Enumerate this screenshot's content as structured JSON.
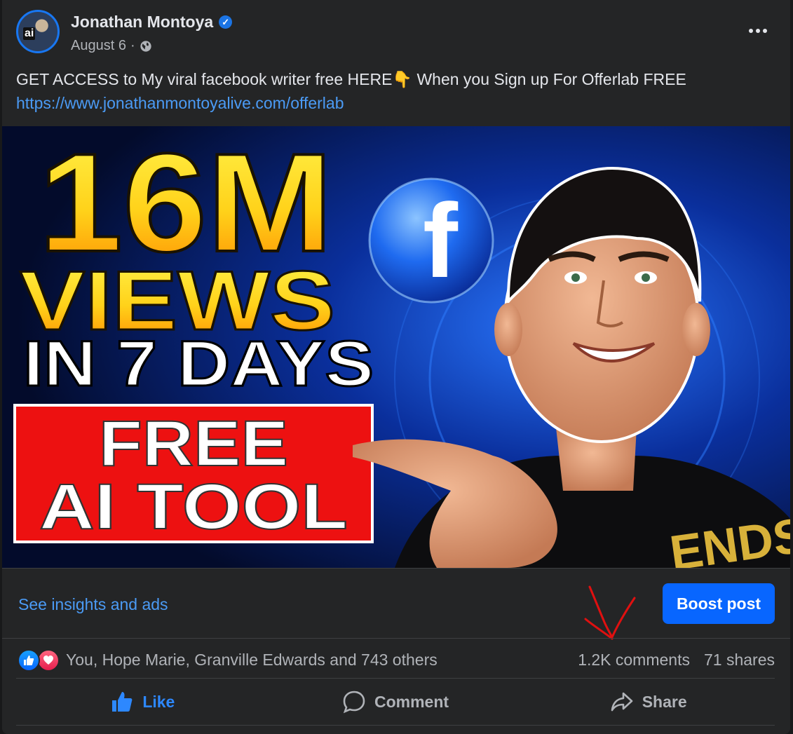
{
  "post": {
    "author": "Jonathan Montoya",
    "verified_icon": "verified-badge-icon",
    "date": "August 6",
    "separator": "·",
    "privacy_icon": "globe-icon",
    "avatar_label": "ai",
    "text": "GET ACCESS to My viral facebook writer free HERE👇 When you Sign up For Offerlab FREE",
    "link": "https://www.jonathanmontoyalive.com/offerlab"
  },
  "media": {
    "headline_line1": "16M",
    "headline_line2": "VIEWS",
    "headline_line3": "IN 7 DAYS",
    "banner_line1": "FREE",
    "banner_line2": "AI TOOL",
    "logo_letter": "f",
    "shirt_text": "ENDS"
  },
  "insights": {
    "link_label": "See insights and ads",
    "boost_label": "Boost post"
  },
  "engagement": {
    "reaction_icons": [
      "like-reaction-icon",
      "love-reaction-icon"
    ],
    "reactors": "You, Hope Marie, Granville Edwards and 743 others",
    "comments": "1.2K comments",
    "shares": "71 shares"
  },
  "actions": {
    "like": "Like",
    "comment": "Comment",
    "share": "Share"
  },
  "colors": {
    "accent": "#0866ff",
    "link": "#4b9bf5",
    "card_bg": "#242526",
    "annotation": "#e01010"
  }
}
